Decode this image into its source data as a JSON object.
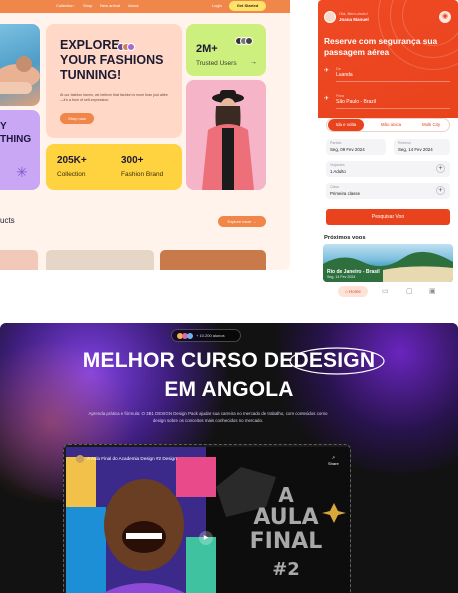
{
  "fashion": {
    "nav": [
      "Collection",
      "Shop",
      "New arrival",
      "About"
    ],
    "login": "Login",
    "get_started": "Get Started",
    "hero_partial": "Y\nTHING",
    "explore_title": "EXPLORE\nYOUR FASHIONS\nTUNNING!",
    "explore_body": "At our fashion haven, we believe that fashion is more than just attire—it's a form of self-expression.",
    "shop_now": "Shop now",
    "trusted_number": "2M+",
    "trusted_label": "Trusted Users",
    "stats": [
      {
        "value": "205K+",
        "label": "Collection"
      },
      {
        "value": "300+",
        "label": "Fashion Brand"
      }
    ],
    "products_heading": "ucts",
    "explore_more": "Explore more"
  },
  "flight": {
    "greeting": "Olá, Bem-vindo!",
    "user_name": "Joana Manuel",
    "title": "Reserve com segurança sua passagem aérea",
    "from_label": "De",
    "from_value": "Luanda",
    "to_label": "Para",
    "to_value": "São Paulo - Brazil",
    "tabs": [
      "Ida e volta",
      "Mão única",
      "Multi City"
    ],
    "active_tab": "Ida e volta",
    "departure_label": "Partida",
    "departure_value": "Seg, 09 Fev 2024",
    "return_label": "Retorno",
    "return_value": "Seg, 14 Fev 2024",
    "travelers_label": "Viajantes",
    "travelers_value": "1 Adulto",
    "class_label": "Class",
    "class_value": "Primeira classe",
    "search_button": "Pesquisar Voo",
    "next_flights": "Próximos voos",
    "next_city": "Rio de Janeiro - Brasil",
    "next_date": "Seg, 14 Fev 2024",
    "nav_home": "Home",
    "accent": "#e8431d"
  },
  "course": {
    "pill_text": "+ 10.200 alunos",
    "headline_line1_a": "MELHOR CURSO DE",
    "headline_line1_b": "DESIGN",
    "headline_line2": "EM ANGOLA",
    "body": "Aprenda prática e fórmula: O 3B1 DESIGN Design Pack ajudar sua carreira no mercado de trabalho, com conteúdos como design sobre os conceitos mais conhecidos no mercado.",
    "video_title": "A Aula Final do Academia Design #2 Design",
    "share_label": "Share",
    "big_line1": "A",
    "big_line2": "AULA",
    "big_line3": "FINAL",
    "big_line4": "#2"
  }
}
